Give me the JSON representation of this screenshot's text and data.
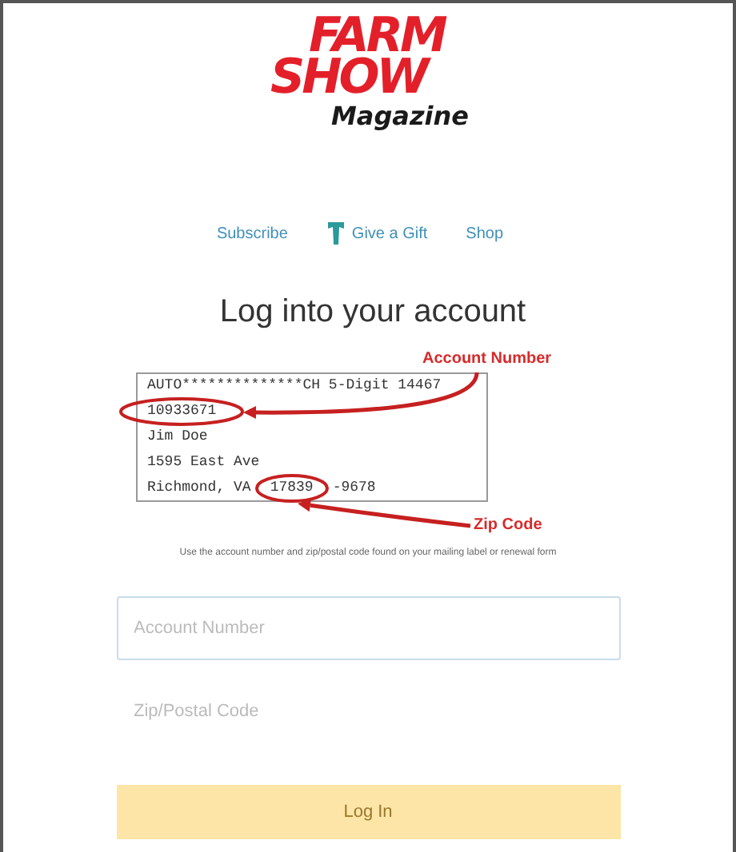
{
  "logo": {
    "line_1": "FARM",
    "line_2": "SHOW",
    "line_3": "Magazine"
  },
  "nav": [
    {
      "label": "Subscribe",
      "kind": "link"
    },
    {
      "label": "Give a Gift",
      "kind": "gift"
    },
    {
      "label": "Shop",
      "kind": "link"
    }
  ],
  "heading": "Log into your account",
  "mailing_label": {
    "lines": [
      "AUTO**************CH 5-Digit 14467",
      "10933671",
      "Jim Doe",
      "1595 East Ave"
    ],
    "last_line": {
      "city": "Richmond, VA",
      "zip": "17839",
      "zip_plus4": "-9678"
    }
  },
  "annotations": [
    {
      "label": "Account Number",
      "kind": "account"
    },
    {
      "label": "Zip Code",
      "kind": "zip"
    }
  ],
  "hint": "Use the account number and zip/postal code found on your mailing label or renewal form",
  "fields": [
    {
      "placeholder": "Account Number",
      "focused": true
    },
    {
      "placeholder": "Zip/Postal Code",
      "focused": false
    }
  ],
  "submit": {
    "label": "Log In",
    "disabled": true
  }
}
